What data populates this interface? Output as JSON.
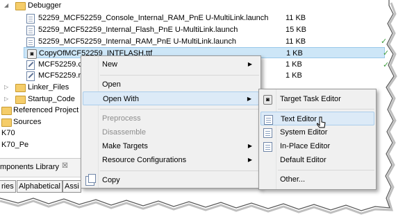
{
  "tree": {
    "debugger_folder": "Debugger",
    "files": [
      {
        "name": "52259_MCF52259_Console_Internal_RAM_PnE U-MultiLink.launch",
        "size": "11 KB"
      },
      {
        "name": "52259_MCF52259_Internal_Flash_PnE U-MultiLink.launch",
        "size": "15 KB"
      },
      {
        "name": "52259_MCF52259_Internal_RAM_PnE U-MultiLink.launch",
        "size": "11 KB"
      },
      {
        "name": "CopyOfMCF52259_INTFLASH.ttf",
        "size": "1 KB"
      },
      {
        "name": "MCF52259.c",
        "size": "1 KB"
      },
      {
        "name": "MCF52259.r",
        "size": "1 KB"
      }
    ],
    "folders": [
      {
        "name": "Linker_Files"
      },
      {
        "name": "Startup_Code"
      }
    ],
    "other_items": [
      "Referenced Project",
      "Sources",
      "K70",
      "K70_Pe"
    ]
  },
  "bottom_view": {
    "title": "mponents Library",
    "close": "☒",
    "tabs": [
      "ries",
      "Alphabetical",
      "Assi"
    ]
  },
  "context_menu": {
    "items": [
      {
        "label": "New",
        "submenu": true,
        "enabled": true
      },
      {
        "label": "Open",
        "submenu": false,
        "enabled": true
      },
      {
        "label": "Open With",
        "submenu": true,
        "enabled": true
      },
      {
        "label": "Preprocess",
        "submenu": false,
        "enabled": false
      },
      {
        "label": "Disassemble",
        "submenu": false,
        "enabled": false
      },
      {
        "label": "Make Targets",
        "submenu": true,
        "enabled": true
      },
      {
        "label": "Resource Configurations",
        "submenu": true,
        "enabled": true
      },
      {
        "label": "Copy",
        "submenu": false,
        "enabled": true
      }
    ]
  },
  "open_with_menu": {
    "items": [
      {
        "label": "Target Task Editor",
        "icon": "target-task-icon"
      },
      {
        "label": "Text Editor",
        "icon": "text-editor-icon"
      },
      {
        "label": "System Editor",
        "icon": "system-editor-icon"
      },
      {
        "label": "In-Place Editor",
        "icon": "in-place-editor-icon"
      },
      {
        "label": "Default Editor",
        "icon": ""
      },
      {
        "label": "Other...",
        "icon": ""
      }
    ],
    "highlighted": "Text Editor"
  },
  "glyphs": {
    "expander": "▷",
    "arrow": "▶"
  }
}
